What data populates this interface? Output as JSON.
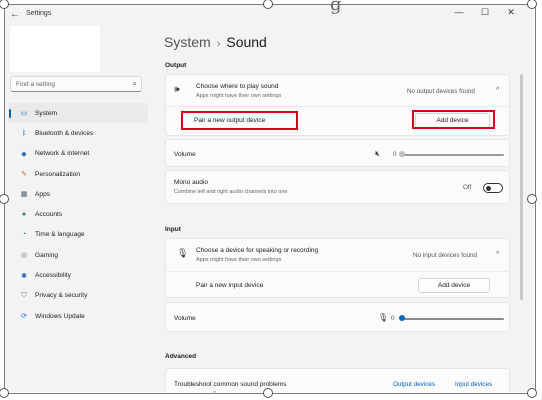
{
  "window": {
    "title": "Settings",
    "back_icon": "back-arrow-icon",
    "controls": {
      "minimize": "—",
      "maximize": "☐",
      "close": "✕"
    }
  },
  "decor": {
    "top_glyph": "g",
    "bottom_glyph": "ˇ"
  },
  "search": {
    "placeholder": "Find a setting",
    "icon": "search-icon"
  },
  "sidebar": {
    "items": [
      {
        "label": "System",
        "icon": "system-icon",
        "glyph": "▭",
        "color": "#0067c0",
        "active": true
      },
      {
        "label": "Bluetooth & devices",
        "icon": "bluetooth-icon",
        "glyph": "ᛒ",
        "color": "#0067c0"
      },
      {
        "label": "Network & internet",
        "icon": "network-icon",
        "glyph": "◆",
        "color": "#2b6fb8"
      },
      {
        "label": "Personalization",
        "icon": "brush-icon",
        "glyph": "✎",
        "color": "#d06020"
      },
      {
        "label": "Apps",
        "icon": "apps-icon",
        "glyph": "▦",
        "color": "#4a5a6a"
      },
      {
        "label": "Accounts",
        "icon": "accounts-icon",
        "glyph": "●",
        "color": "#1f8a4c"
      },
      {
        "label": "Time & language",
        "icon": "time-language-icon",
        "glyph": "◔",
        "color": "#1a73b8"
      },
      {
        "label": "Gaming",
        "icon": "gaming-icon",
        "glyph": "◎",
        "color": "#6a6a6a"
      },
      {
        "label": "Accessibility",
        "icon": "accessibility-icon",
        "glyph": "✱",
        "color": "#1a5fb4"
      },
      {
        "label": "Privacy & security",
        "icon": "shield-icon",
        "glyph": "⛉",
        "color": "#6a6a6a"
      },
      {
        "label": "Windows Update",
        "icon": "windows-update-icon",
        "glyph": "⟳",
        "color": "#1a73e8"
      }
    ]
  },
  "header": {
    "crumb": "System",
    "separator": "›",
    "title": "Sound"
  },
  "output": {
    "section_label": "Output",
    "choose": {
      "title": "Choose where to play sound",
      "subtitle": "Apps might have their own settings",
      "status": "No output devices found",
      "icon": "speaker-icon",
      "chevron": "^"
    },
    "pair": {
      "label": "Pair a new output device",
      "button": "Add device"
    },
    "volume": {
      "label": "Volume",
      "value": "0",
      "muted_icon": "speaker-muted-icon",
      "level": 0
    },
    "mono": {
      "title": "Mono audio",
      "subtitle": "Combine left and right audio channels into one",
      "state": "Off"
    }
  },
  "input": {
    "section_label": "Input",
    "choose": {
      "title": "Choose a device for speaking or recording",
      "subtitle": "Apps might have their own settings",
      "status": "No input devices found",
      "icon": "microphone-icon",
      "chevron": "^"
    },
    "pair": {
      "label": "Pair a new input device",
      "button": "Add device"
    },
    "volume": {
      "label": "Volume",
      "value": "0",
      "mic_icon": "microphone-icon",
      "level": 0
    }
  },
  "advanced": {
    "section_label": "Advanced",
    "troubleshoot": {
      "label": "Troubleshoot common sound problems",
      "link1": "Output devices",
      "link2": "Input devices"
    }
  },
  "colors": {
    "accent": "#0067c0",
    "highlight": "#d9001b",
    "link": "#005fb8"
  }
}
